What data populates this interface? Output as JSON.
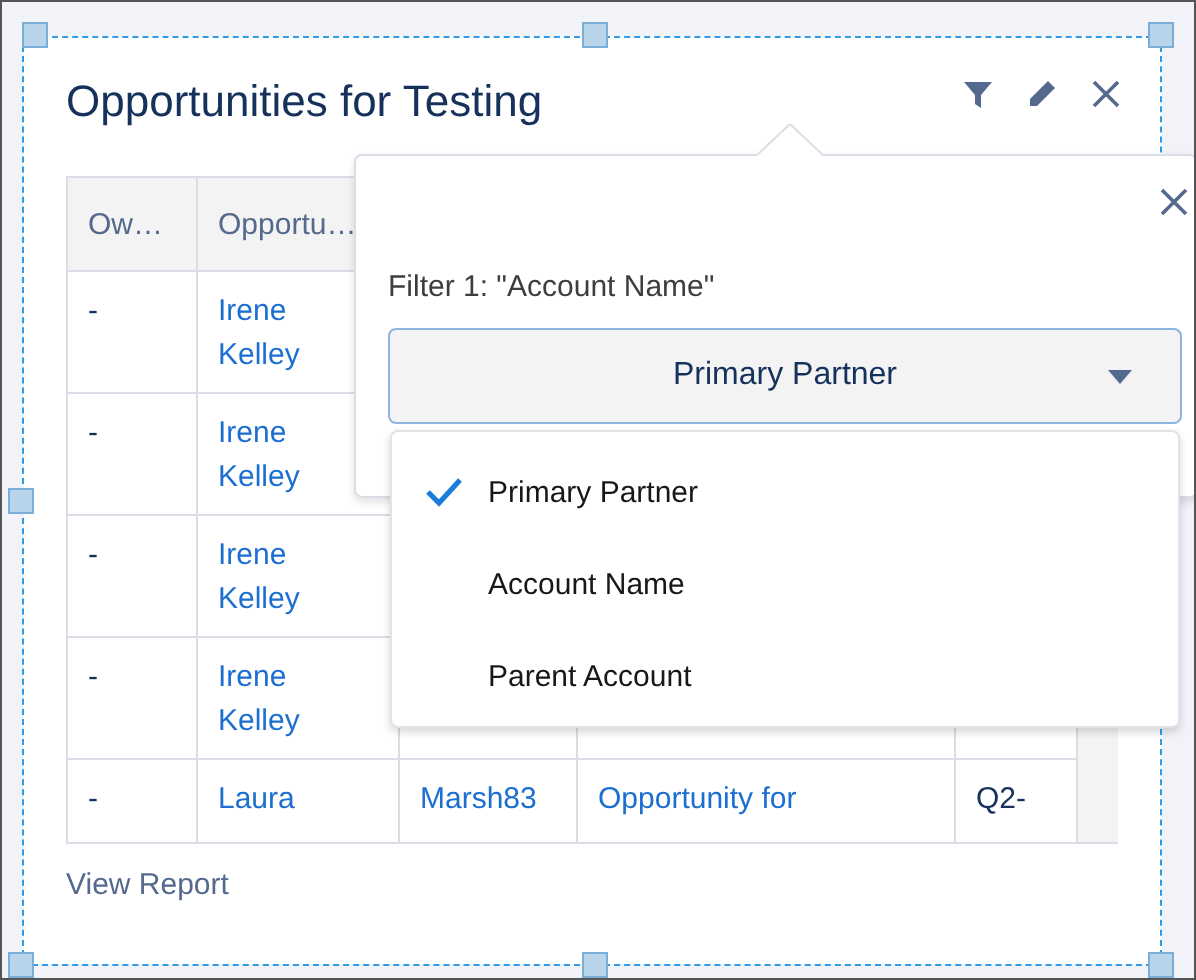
{
  "card": {
    "title": "Opportunities for Testing",
    "footer_link": "View Report"
  },
  "table": {
    "columns": [
      "Ow…",
      "Opportu…"
    ],
    "rows": [
      {
        "column_1": "-",
        "column_2": "Irene Kelley"
      },
      {
        "column_1": "-",
        "column_2": "Irene Kelley"
      },
      {
        "column_1": "-",
        "column_2": "Irene Kelley"
      },
      {
        "column_1": "-",
        "column_2": "Irene Kelley"
      },
      {
        "column_1": "-",
        "column_2": "Laura",
        "column_3": "Marsh83",
        "column_4": "Opportunity for",
        "column_5": "Q2-"
      }
    ]
  },
  "filter_popover": {
    "label": "Filter 1: \"Account Name\"",
    "value": "Primary Partner",
    "options": [
      {
        "label": "Primary Partner",
        "selected": true
      },
      {
        "label": "Account Name",
        "selected": false
      },
      {
        "label": "Parent Account",
        "selected": false
      }
    ]
  }
}
